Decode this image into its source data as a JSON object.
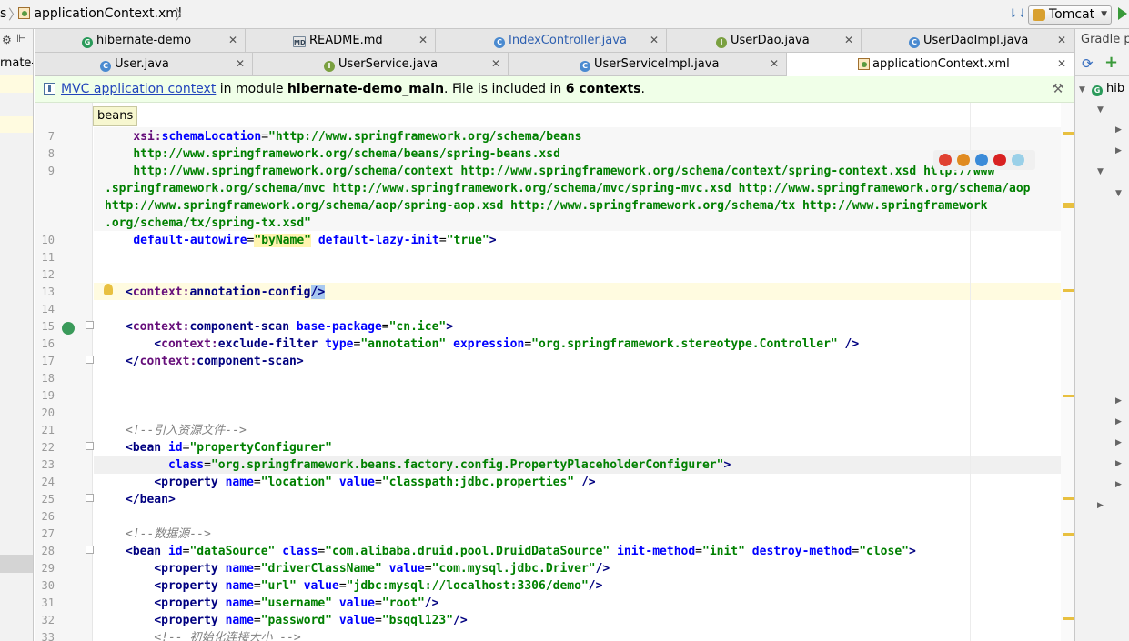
{
  "navbar": {
    "crumb_prev": "s",
    "crumb_file": "applicationContext.xml",
    "run_config": "Tomcat"
  },
  "left_panel": {
    "label": "rnate-"
  },
  "tabs_row1": [
    {
      "label": "hibernate-demo",
      "icon": "gradle-module-icon"
    },
    {
      "label": "README.md",
      "icon": "markdown-file-icon"
    },
    {
      "label": "IndexController.java",
      "icon": "class-icon"
    },
    {
      "label": "UserDao.java",
      "icon": "interface-icon"
    },
    {
      "label": "UserDaoImpl.java",
      "icon": "class-icon"
    }
  ],
  "tabs_row2": [
    {
      "label": "User.java",
      "icon": "class-icon"
    },
    {
      "label": "UserService.java",
      "icon": "interface-icon"
    },
    {
      "label": "UserServiceImpl.java",
      "icon": "class-icon"
    },
    {
      "label": "applicationContext.xml",
      "icon": "xml-file-icon"
    }
  ],
  "banner": {
    "link": "MVC application context",
    "text1": " in module ",
    "module": "hibernate-demo_main",
    "text2": ". File is included in ",
    "count": "6 contexts",
    "text3": "."
  },
  "tooltip": "beans",
  "editor": {
    "line_numbers": [
      "7",
      "8",
      "9",
      "10",
      "11",
      "12",
      "13",
      "14",
      "15",
      "16",
      "17",
      "18",
      "19",
      "20",
      "21",
      "22",
      "23",
      "24",
      "25",
      "26",
      "27",
      "28",
      "29",
      "30",
      "31",
      "32",
      "33"
    ]
  },
  "gradle": {
    "title": "Gradle pr",
    "root": "hib"
  },
  "colors": {
    "banner_bg": "#f0ffe8",
    "xml_tag": "#000080",
    "xml_attr": "#0000ff",
    "xml_value": "#008000",
    "comment": "#808080"
  }
}
